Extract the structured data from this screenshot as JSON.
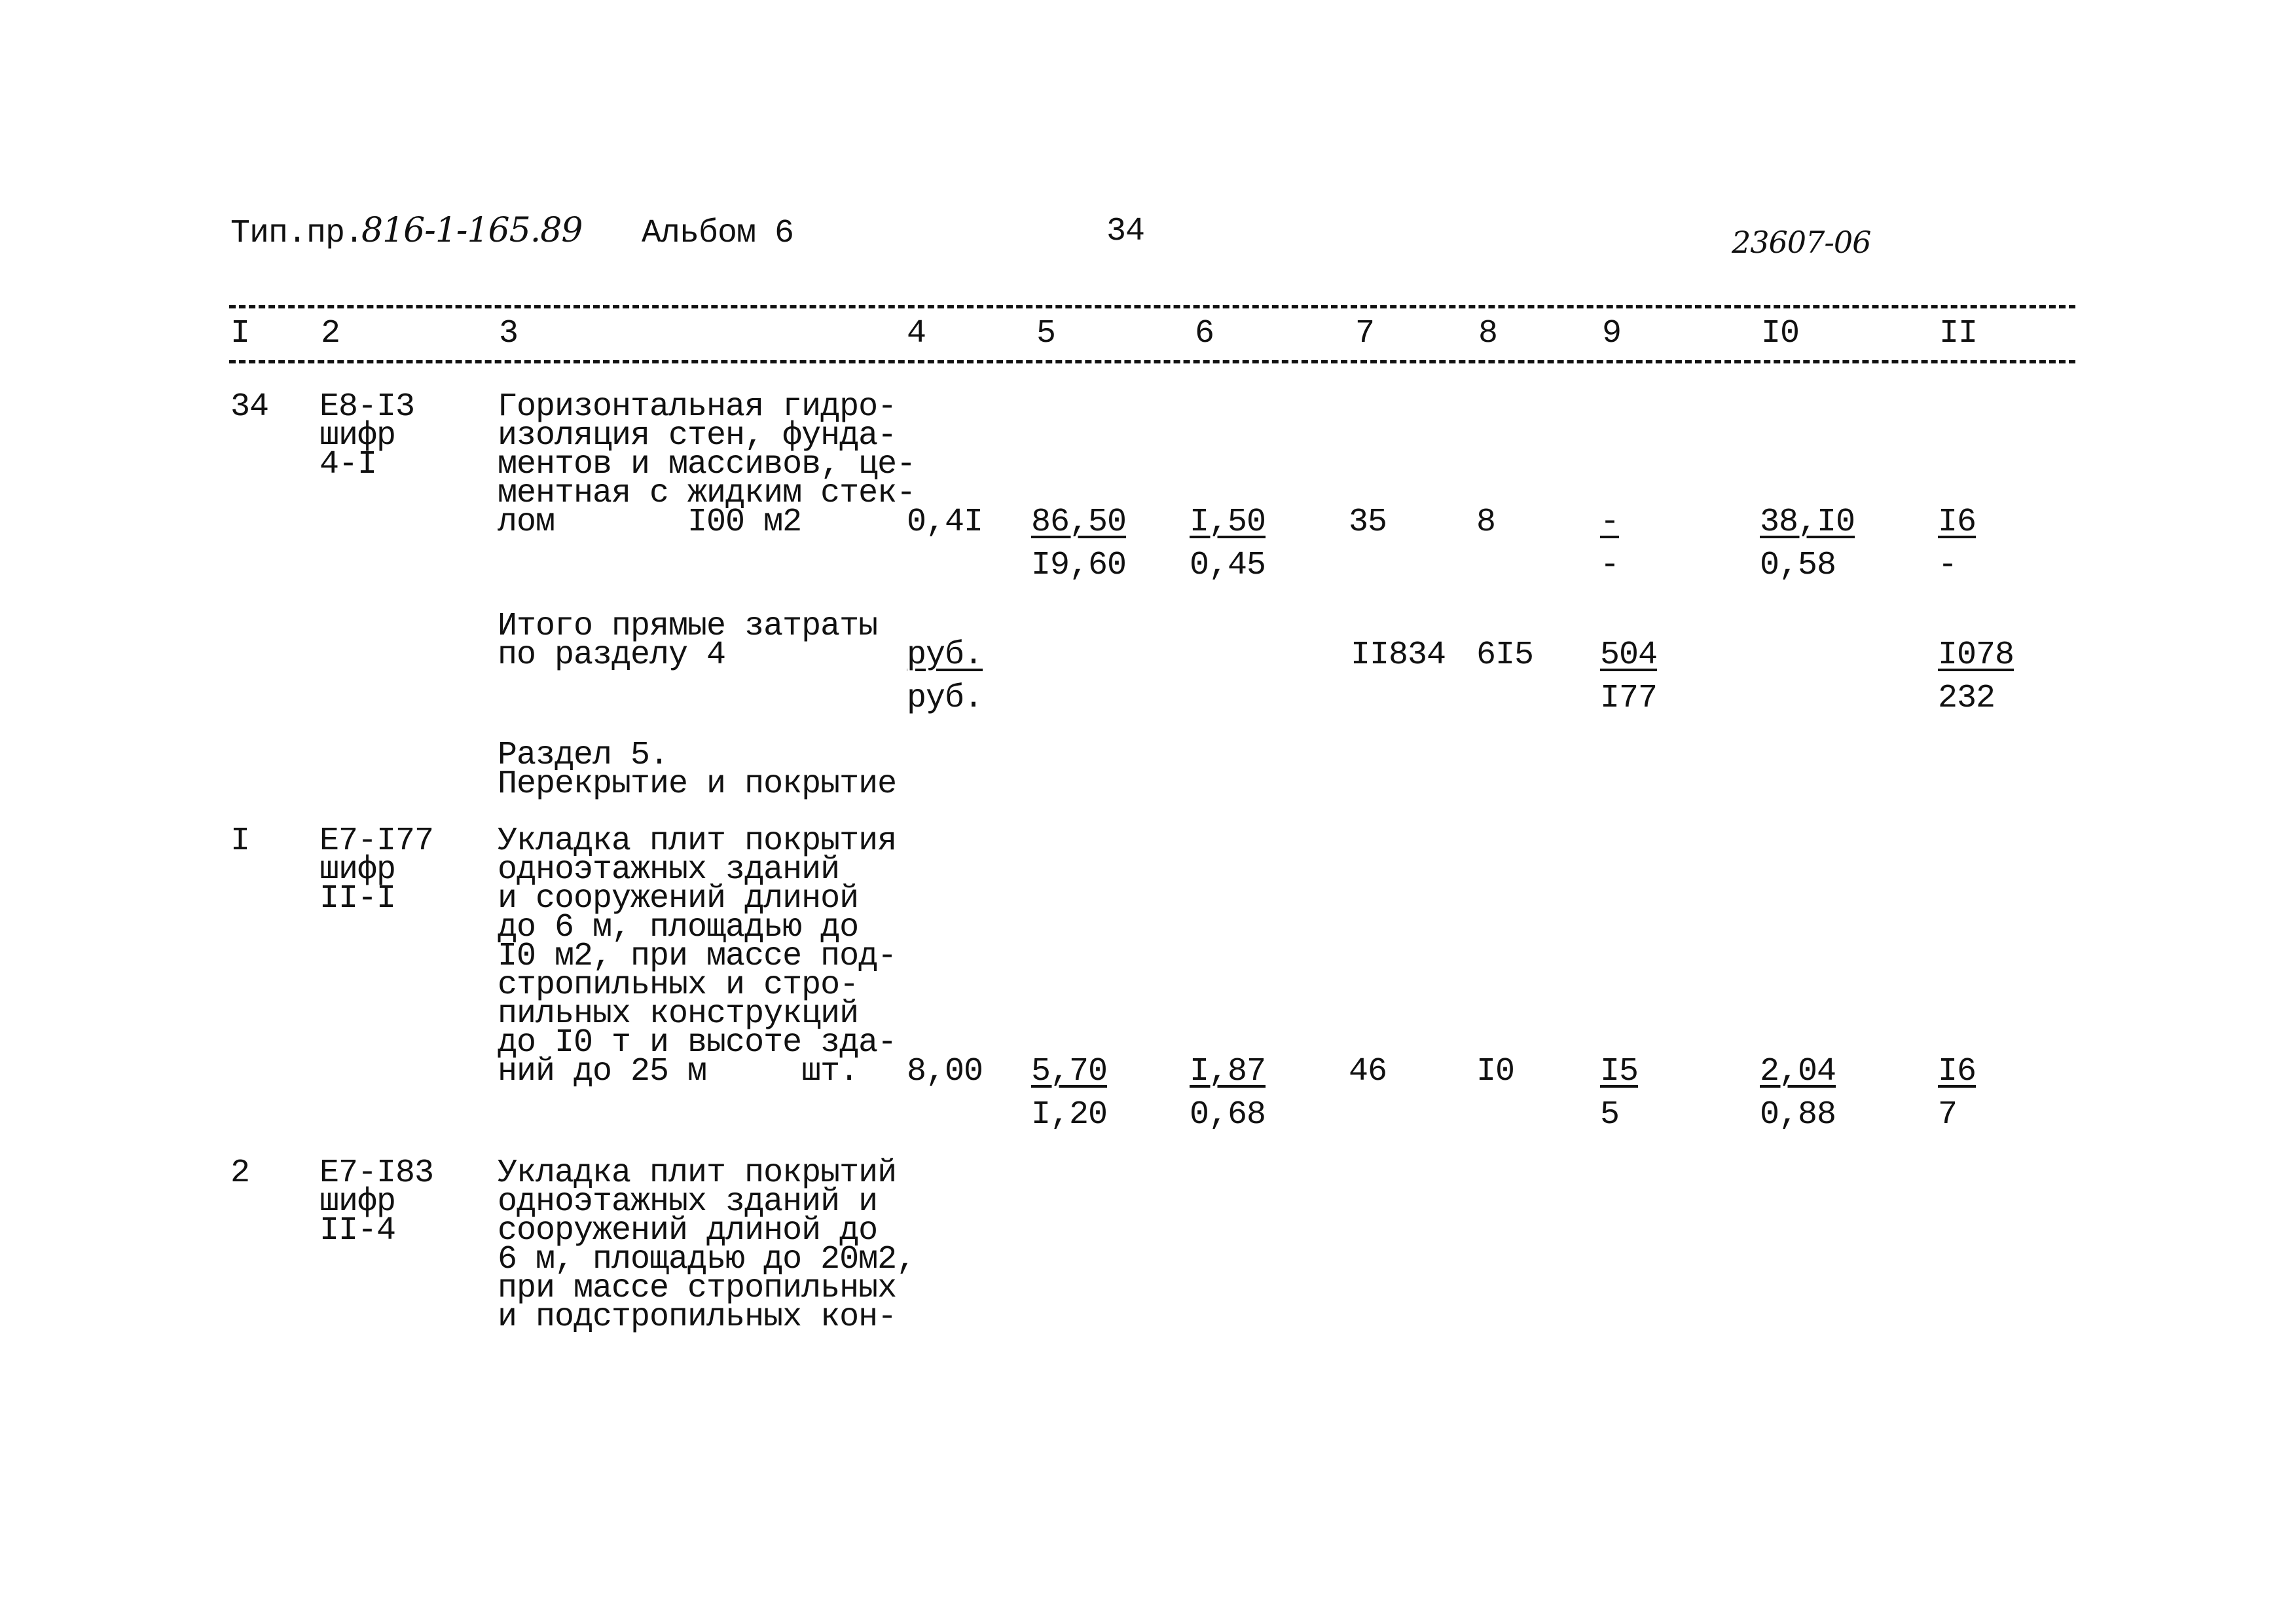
{
  "header": {
    "prefix": "Тип.пр.",
    "project_number": "816-1-165.89",
    "album": "Альбом 6",
    "page_number": "34",
    "doc_code": "23607-06"
  },
  "columns": [
    "I",
    "2",
    "3",
    "4",
    "5",
    "6",
    "7",
    "8",
    "9",
    "I0",
    "II"
  ],
  "rows": [
    {
      "num": "34",
      "code": [
        "Е8-I3",
        "шифр",
        "4-I"
      ],
      "description": [
        "Горизонтальная гидро-",
        "изоляция стен, фунда-",
        "ментов и массивов, це-",
        "ментная с жидким стек-",
        "лом       I00 м2"
      ],
      "qty": "0,4I",
      "c5": {
        "top": "86,50",
        "bottom": "I9,60"
      },
      "c6": {
        "top": "I,50",
        "bottom": "0,45"
      },
      "c7": "35",
      "c8": "8",
      "c9": {
        "top": "-",
        "bottom": "-"
      },
      "c10": {
        "top": "38,I0",
        "bottom": "0,58"
      },
      "c11": {
        "top": "I6",
        "bottom": "-"
      }
    },
    {
      "subtotal_label": [
        "Итого прямые затраты",
        "по разделу 4"
      ],
      "unit_top": "руб.",
      "unit_bottom": "руб.",
      "c7": "II834",
      "c8": "6I5",
      "c9": {
        "top": "504",
        "bottom": "I77"
      },
      "c11": {
        "top": "I078",
        "bottom": "232"
      }
    },
    {
      "section_title": [
        "Раздел 5.",
        "Перекрытие и покрытие"
      ]
    },
    {
      "num": "I",
      "code": [
        "Е7-I77",
        "шифр",
        "II-I"
      ],
      "description": [
        "Укладка плит покрытия",
        "одноэтажных зданий",
        "и сооружений длиной",
        "до 6 м, площадью до",
        "I0 м2, при массе под-",
        "стропильных и стро-",
        "пильных конструкций",
        "до I0 т и высоте зда-",
        "ний до 25 м     шт."
      ],
      "qty": "8,00",
      "c5": {
        "top": "5,70",
        "bottom": "I,20"
      },
      "c6": {
        "top": "I,87",
        "bottom": "0,68"
      },
      "c7": "46",
      "c8": "I0",
      "c9": {
        "top": "I5",
        "bottom": "5"
      },
      "c10": {
        "top": "2,04",
        "bottom": "0,88"
      },
      "c11": {
        "top": "I6",
        "bottom": "7"
      }
    },
    {
      "num": "2",
      "code": [
        "Е7-I83",
        "шифр",
        "II-4"
      ],
      "description": [
        "Укладка плит покрытий",
        "одноэтажных зданий и",
        "сооружений длиной до",
        "6 м, площадью до 20м2,",
        "при массе стропильных",
        "и подстропильных кон-"
      ]
    }
  ]
}
